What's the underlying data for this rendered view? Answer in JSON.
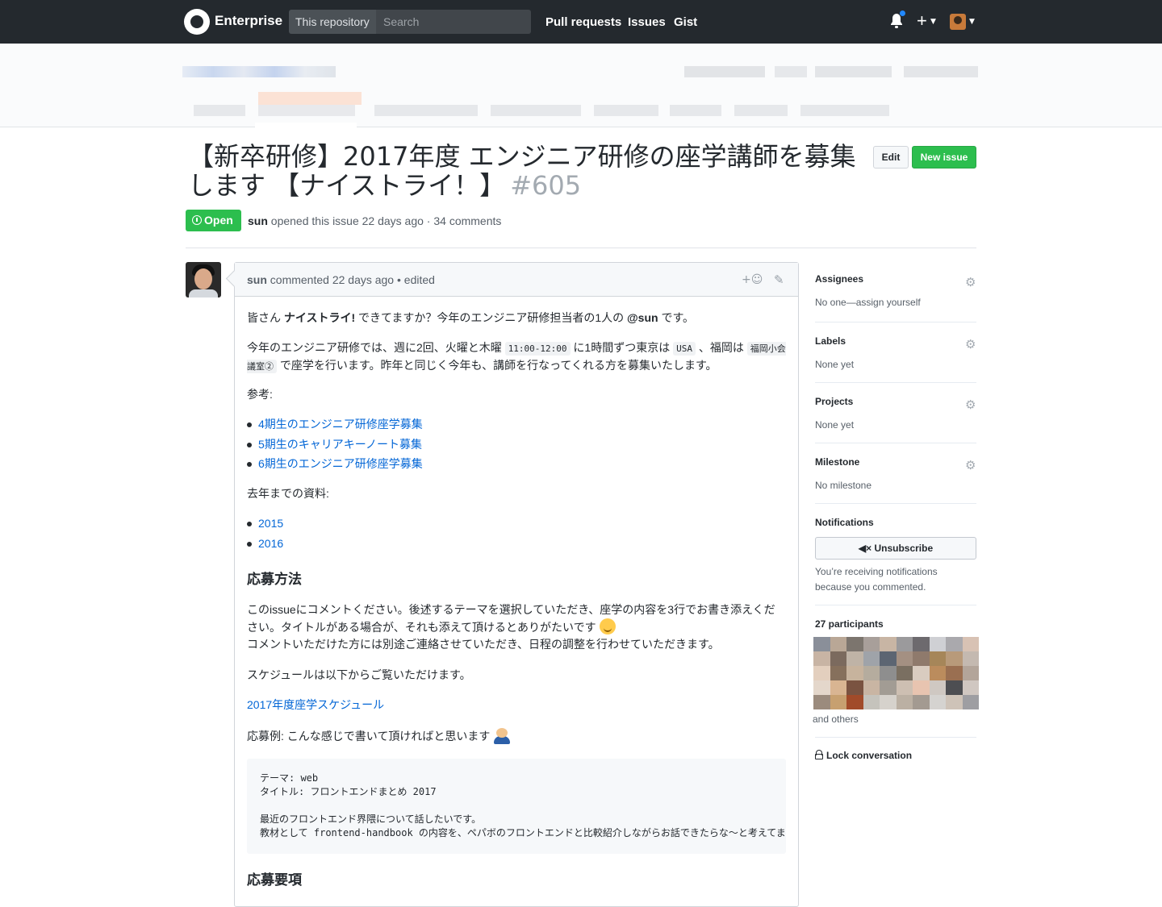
{
  "header": {
    "brand": "Enterprise",
    "scope": "This repository",
    "search_placeholder": "Search",
    "nav": [
      "Pull requests",
      "Issues",
      "Gist"
    ]
  },
  "issue": {
    "title": "【新卒研修】2017年度 エンジニア研修の座学講師を募集します 【ナイストライ！】",
    "number": "#605",
    "edit_label": "Edit",
    "new_issue_label": "New issue",
    "state": "Open",
    "author": "sun",
    "meta": " opened this issue 22 days ago · 34 comments"
  },
  "comment": {
    "author": "sun",
    "header_rest": " commented 22 days ago • edited",
    "p1_a": "皆さん ",
    "p1_b": "ナイストライ!",
    "p1_c": " できてますか？今年のエンジニア研修担当者の1人の ",
    "p1_mention": "@sun",
    "p1_d": " です。",
    "p2_a": "今年のエンジニア研修では、週に2回、火曜と木曜 ",
    "p2_code1": "11:00-12:00",
    "p2_b": " に1時間ずつ東京は ",
    "p2_code2": "USA",
    "p2_c": " 、福岡は ",
    "p2_code3": "福岡小会議室②",
    "p2_d": " で座学を行います。昨年と同じく今年も、講師を行なってくれる方を募集いたします。",
    "ref_label": "参考:",
    "refs": [
      "4期生のエンジニア研修座学募集",
      "5期生のキャリアキーノート募集",
      "6期生のエンジニア研修座学募集"
    ],
    "past_label": "去年までの資料:",
    "past": [
      "2015",
      "2016"
    ],
    "h_apply": "応募方法",
    "apply1": "このissueにコメントください。後述するテーマを選択していただき、座学の内容を3行でお書き添えください。タイトルがある場合が、それも添えて頂けるとありがたいです",
    "apply2": "コメントいただけた方には別途ご連絡させていただき、日程の調整を行わせていただきます。",
    "schedule_text": "スケジュールは以下からご覧いただけます。",
    "schedule_link": "2017年度座学スケジュール",
    "example_label": "応募例: こんな感じで書いて頂ければと思います",
    "code_block": "テーマ: web\nタイトル: フロントエンドまとめ 2017\n\n最近のフロントエンド界隈について話したいです。\n教材として frontend-handbook の内容を、ペパボのフロントエンドと比較紹介しながらお話できたらな〜と考えてます",
    "h_requirements": "応募要項"
  },
  "sidebar": {
    "assignees": "Assignees",
    "assignees_value": "No one—assign yourself",
    "labels": "Labels",
    "labels_value": "None yet",
    "projects": "Projects",
    "projects_value": "None yet",
    "milestone": "Milestone",
    "milestone_value": "No milestone",
    "notifications": "Notifications",
    "unsubscribe": "Unsubscribe",
    "notice": "You’re receiving notifications because you commented.",
    "participants": "27 participants",
    "others": "and others",
    "lock": "Lock conversation"
  },
  "colors": {
    "header_bg": "#24292e",
    "open_green": "#2cbe4e",
    "link_blue": "#0366d6"
  }
}
